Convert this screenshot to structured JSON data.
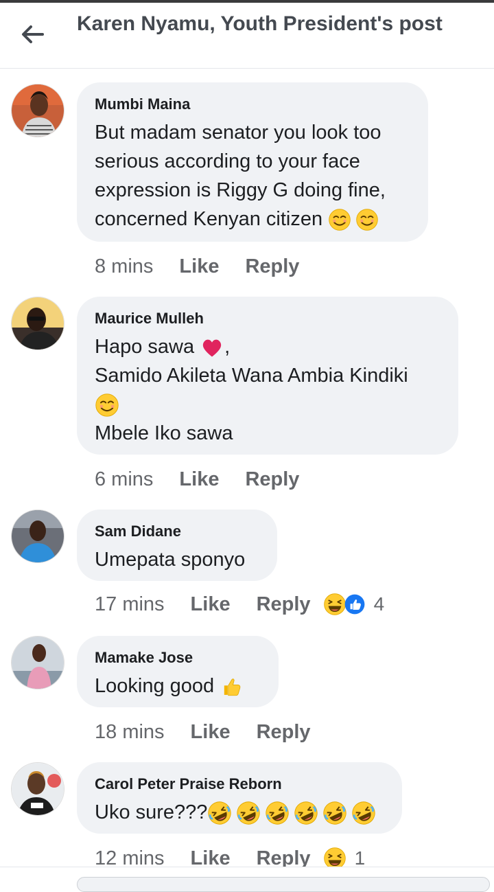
{
  "header": {
    "title": "Karen Nyamu, Youth President's post"
  },
  "comments": [
    {
      "author": "Mumbi Maina",
      "lines": [
        "But madam senator you look too serious according to your face expression is Riggy G doing fine, concerned Kenyan citizen"
      ],
      "time": "8 mins",
      "like": "Like",
      "reply": "Reply"
    },
    {
      "author": "Maurice Mulleh",
      "lines": [
        "Hapo sawa",
        ",",
        "Samido Akileta Wana Ambia Kindiki",
        "Mbele Iko sawa"
      ],
      "time": "6 mins",
      "like": "Like",
      "reply": "Reply"
    },
    {
      "author": "Sam Didane",
      "lines": [
        "Umepata sponyo"
      ],
      "time": "17 mins",
      "like": "Like",
      "reply": "Reply",
      "reaction_count": "4"
    },
    {
      "author": "Mamake Jose",
      "lines": [
        "Looking good"
      ],
      "time": "18 mins",
      "like": "Like",
      "reply": "Reply"
    },
    {
      "author": "Carol Peter Praise Reborn",
      "lines": [
        "Uko sure???"
      ],
      "time": "12 mins",
      "like": "Like",
      "reply": "Reply",
      "reaction_count": "1"
    }
  ],
  "icons": {
    "back": "arrow-left-icon",
    "smirk": "smiling-face-icon",
    "heart": "red-heart-icon",
    "laugh": "laughing-face-icon",
    "thumbs": "thumbs-up-icon",
    "rofl": "rolling-laughing-face-icon"
  },
  "colors": {
    "bubble": "#f0f2f5",
    "meta_text": "#65676b",
    "like_blue": "#1877f2",
    "heart_red": "#e0245e",
    "emoji_yellow": "#ffcc33"
  }
}
